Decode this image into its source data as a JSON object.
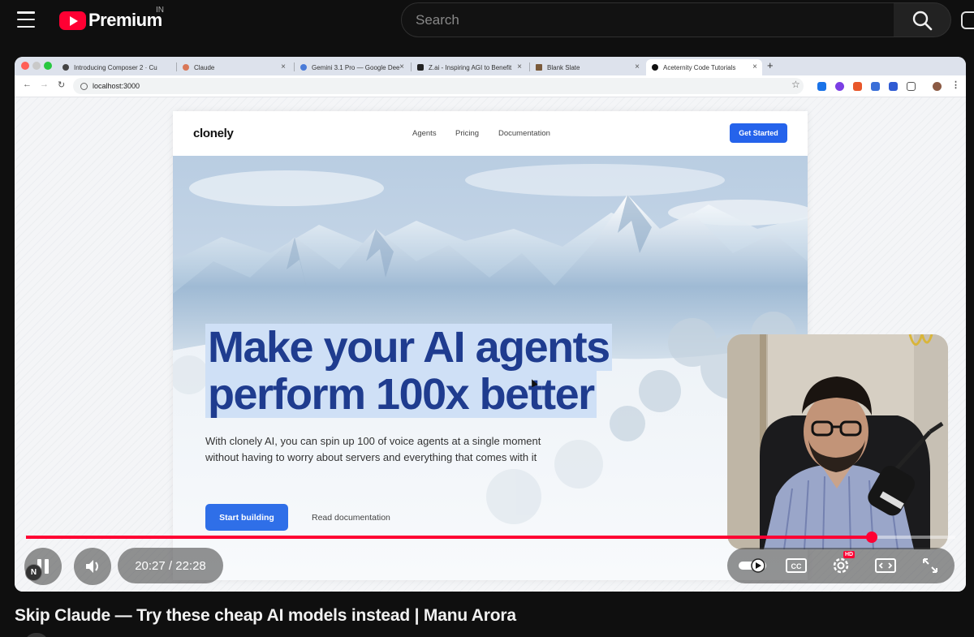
{
  "youtube": {
    "logo_text": "Premium",
    "region": "IN",
    "search_placeholder": "Search",
    "video_title": "Skip Claude — Try these cheap AI models instead | Manu Arora"
  },
  "browser": {
    "tabs": [
      {
        "label": "Introducing Composer 2 · Cu",
        "favicon_color": "#444444"
      },
      {
        "label": "Claude",
        "favicon_color": "#d97757"
      },
      {
        "label": "Gemini 3.1 Pro — Google Dee",
        "favicon_color": "#4a7bd8"
      },
      {
        "label": "Z.ai - Inspiring AGI to Benefit",
        "favicon_color": "#222222"
      },
      {
        "label": "Blank Slate",
        "favicon_color": "#7a5a3a"
      },
      {
        "label": "Aceternity Code Tutorials",
        "favicon_color": "#111111"
      }
    ],
    "url": "localhost:3000"
  },
  "site": {
    "brand": "clonely",
    "nav": [
      "Agents",
      "Pricing",
      "Documentation"
    ],
    "cta_top": "Get Started",
    "headline_line1": "Make your AI agents",
    "headline_line2": "perform 100x better",
    "subtext": "With clonely AI, you can spin up 100 of voice agents at a single moment without having to worry about servers and everything that comes with it",
    "cta_primary": "Start building",
    "cta_secondary": "Read documentation",
    "accent_color": "#2563eb",
    "headline_color": "#1f3c8f"
  },
  "player": {
    "time_current": "20:27",
    "time_total": "22:28",
    "time_display": "20:27 / 22:28",
    "progress": 0.91,
    "channel_badge": "N",
    "settings_badge": "HD",
    "progress_color": "#ff0033"
  }
}
